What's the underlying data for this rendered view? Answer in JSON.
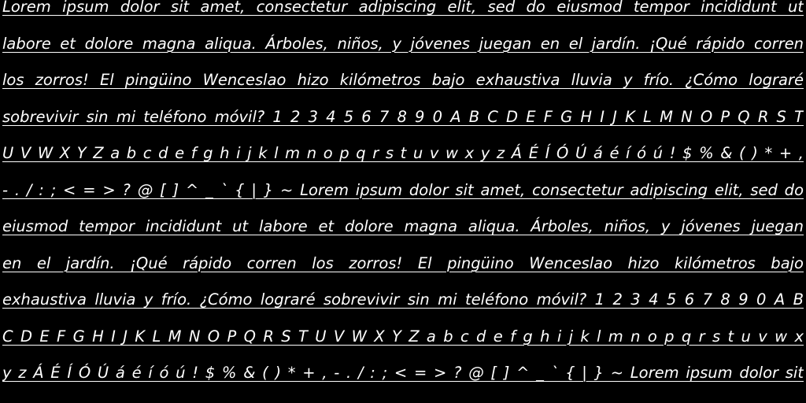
{
  "document": {
    "lines": [
      "Lorem ipsum dolor sit amet, consectetur adipiscing elit, sed do eiusmod tempor incididunt ut",
      "labore et dolore magna aliqua. Árboles, niños, y jóvenes juegan en el jardín. ¡Qué rápido corren",
      "los zorros! El pingüino Wenceslao hizo kilómetros bajo exhaustiva lluvia y frío. ¿Cómo lograré",
      "sobrevivir sin mi teléfono móvil? 1 2 3 4 5 6 7 8 9 0 A B C D E F G H I J K L M N O P Q R S T",
      "U V W X Y Z a b c d e f g h i j k l m n o p q r s t u v w x y z Á É Í Ó Ú á é í ó ú ! $ % & ( ) * + ,",
      "- . / : ; < = > ? @ [ ] ^ _ ` { | } ~ Lorem ipsum dolor sit amet, consectetur adipiscing elit, sed do",
      "eiusmod tempor incididunt ut labore et dolore magna aliqua. Árboles, niños, y jóvenes juegan",
      "en el jardín. ¡Qué rápido corren los zorros! El pingüino Wenceslao hizo kilómetros bajo",
      "exhaustiva lluvia y frío. ¿Cómo lograré sobrevivir sin mi teléfono móvil? 1 2 3 4 5 6 7 8 9 0 A B",
      "C D E F G H I J K L M N O P Q R S T U V W X Y Z a b c d e f g h i j k l m n o p q r s t u v w x",
      "y z Á É Í Ó Ú á é í ó ú ! $ % & ( ) * + , - . / : ; < = > ? @ [ ] ^ _ ` { | } ~ Lorem ipsum dolor sit"
    ]
  }
}
